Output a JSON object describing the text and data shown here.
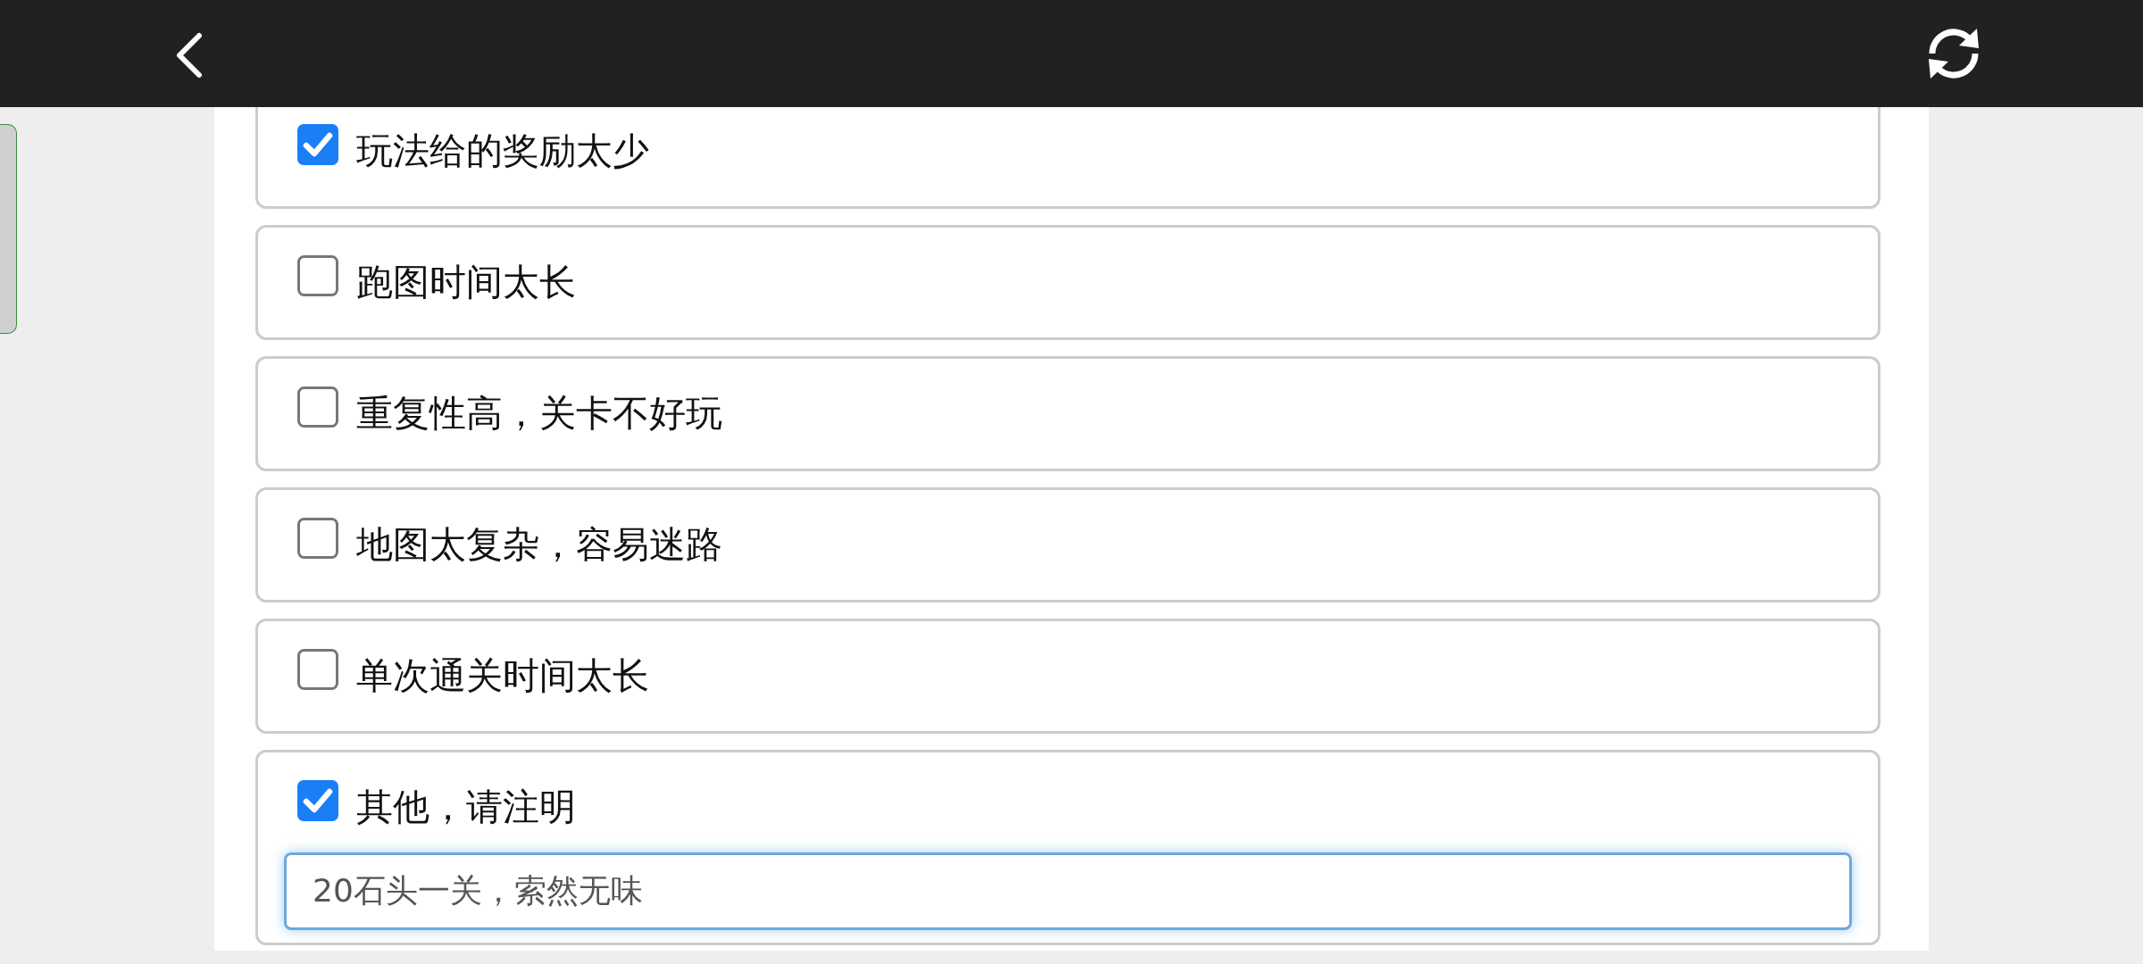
{
  "options": [
    {
      "kind": "option",
      "label": "玩法给的奖励太少",
      "checked": true
    },
    {
      "kind": "option",
      "label": "跑图时间太长",
      "checked": false
    },
    {
      "kind": "option",
      "label": "重复性高，关卡不好玩",
      "checked": false
    },
    {
      "kind": "option",
      "label": "地图太复杂，容易迷路",
      "checked": false
    },
    {
      "kind": "option",
      "label": "单次通关时间太长",
      "checked": false
    },
    {
      "kind": "other",
      "label": "其他，请注明",
      "checked": true,
      "input": {
        "value": "20石头一关，索然无味",
        "focused": true
      }
    }
  ]
}
